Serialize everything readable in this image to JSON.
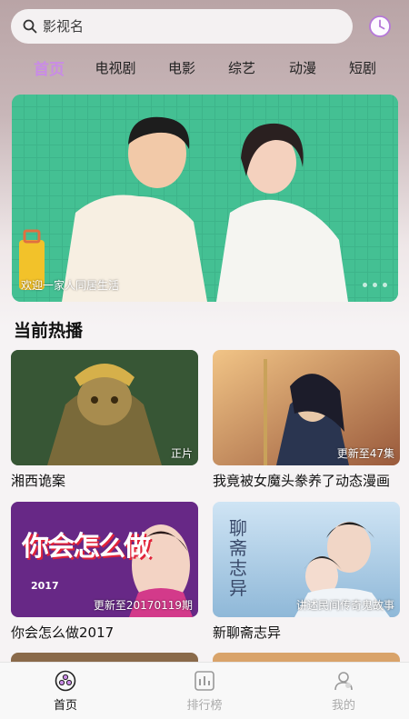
{
  "search": {
    "placeholder": "影视名"
  },
  "tabs": [
    {
      "label": "首页"
    },
    {
      "label": "电视剧"
    },
    {
      "label": "电影"
    },
    {
      "label": "综艺"
    },
    {
      "label": "动漫"
    },
    {
      "label": "短剧"
    }
  ],
  "banner": {
    "caption": "欢迎一家人同居生活"
  },
  "section": {
    "title": "当前热播"
  },
  "cards": [
    {
      "title": "湘西诡案",
      "badge": "正片"
    },
    {
      "title": "我竟被女魔头豢养了动态漫画",
      "badge": "更新至47集"
    },
    {
      "title": "你会怎么做2017",
      "badge": "更新至20170119期",
      "poster_text": "你会怎么做",
      "poster_year": "2017"
    },
    {
      "title": "新聊斋志异",
      "badge": "讲述民间传奇鬼故事",
      "poster_text": "聊斋志异"
    }
  ],
  "nav": [
    {
      "label": "首页",
      "icon": "home-icon"
    },
    {
      "label": "排行榜",
      "icon": "ranking-icon"
    },
    {
      "label": "我的",
      "icon": "profile-icon"
    }
  ],
  "colors": {
    "accent": "#c98be6",
    "banner_green": "#3fbb8e"
  }
}
